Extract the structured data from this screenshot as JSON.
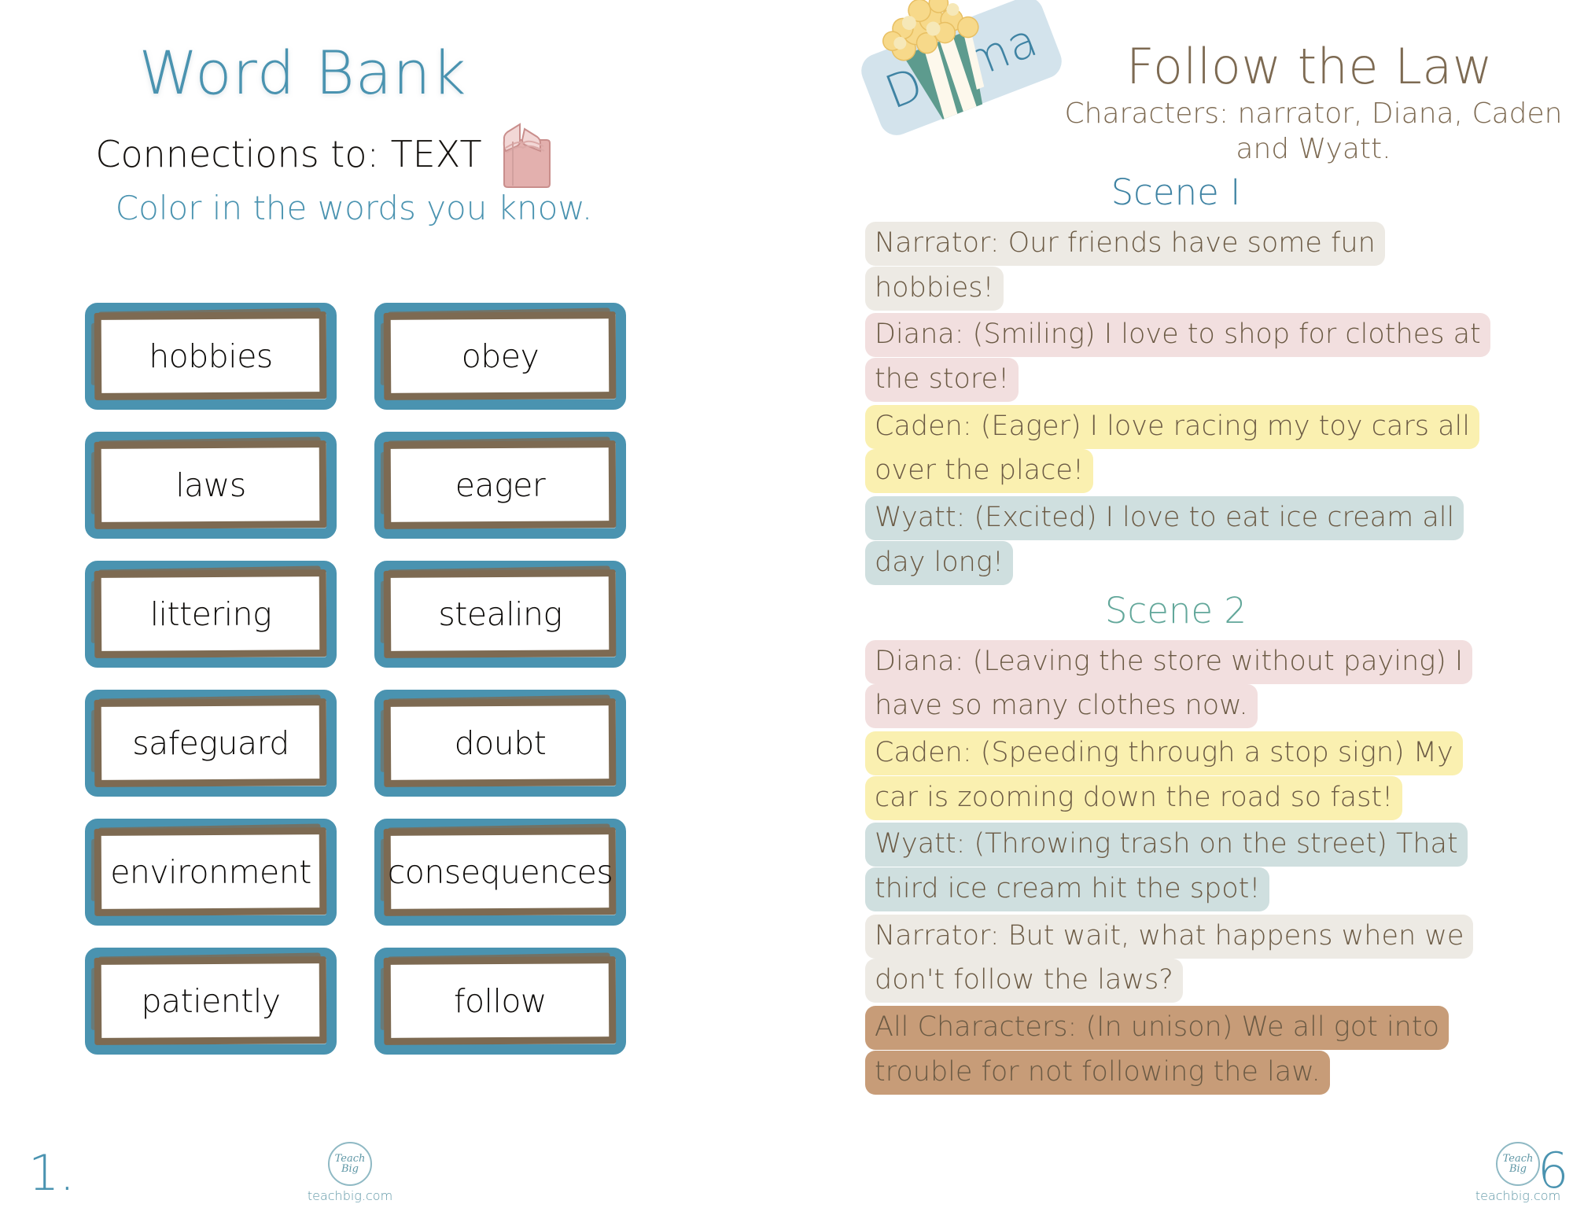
{
  "left_page": {
    "title": "Word Bank",
    "subtitle": "Connections to:  TEXT",
    "instruction": "Color in the words you know.",
    "book_icon": "book-icon",
    "words": [
      "hobbies",
      "obey",
      "laws",
      "eager",
      "littering",
      "stealing",
      "safeguard",
      "doubt",
      "environment",
      "consequences",
      "patiently",
      "follow"
    ],
    "page_number": "1."
  },
  "right_page": {
    "badge_label": "Drama",
    "popcorn_icon": "popcorn-icon",
    "title": "Follow the Law",
    "characters": "Characters: narrator, Diana, Caden and Wyatt.",
    "scene_1_heading": "Scene I",
    "scene_2_heading": "Scene 2",
    "scene_1_lines": [
      {
        "speaker": "narrator",
        "text": "Narrator:  Our friends have some fun hobbies!"
      },
      {
        "speaker": "diana",
        "text": "Diana: (Smiling) I love to shop for clothes at the store!"
      },
      {
        "speaker": "caden",
        "text": "Caden: (Eager) I love racing my toy cars all over the place!"
      },
      {
        "speaker": "wyatt",
        "text": "Wyatt: (Excited) I love to eat ice cream all day long!"
      }
    ],
    "scene_2_lines": [
      {
        "speaker": "diana",
        "text": "Diana: (Leaving the store without paying) I have so many clothes now."
      },
      {
        "speaker": "caden",
        "text": "Caden: (Speeding through a stop sign) My car is zooming down the road so fast!"
      },
      {
        "speaker": "wyatt",
        "text": "Wyatt: (Throwing trash on the street) That third ice cream hit the spot!"
      },
      {
        "speaker": "narrator",
        "text": "Narrator: But wait, what happens when we don't follow the laws?"
      },
      {
        "speaker": "all",
        "text": "All Characters: (In unison) We all got into trouble for not following the law."
      }
    ],
    "page_number": "6."
  },
  "footer": {
    "logo_mark": "Teach Big",
    "logo_url": "teachbig.com"
  },
  "colors": {
    "teal": "#4a93b0",
    "brown": "#7d6a52",
    "scene2_green": "#62a79a",
    "hl_narrator": "#edeae4",
    "hl_diana": "#f2dfdf",
    "hl_caden": "#faf0b0",
    "hl_wyatt": "#cfdfdf",
    "hl_all": "#c79c78",
    "badge_bg": "#d3e3ec",
    "book_pink": "#e3b0ae"
  }
}
